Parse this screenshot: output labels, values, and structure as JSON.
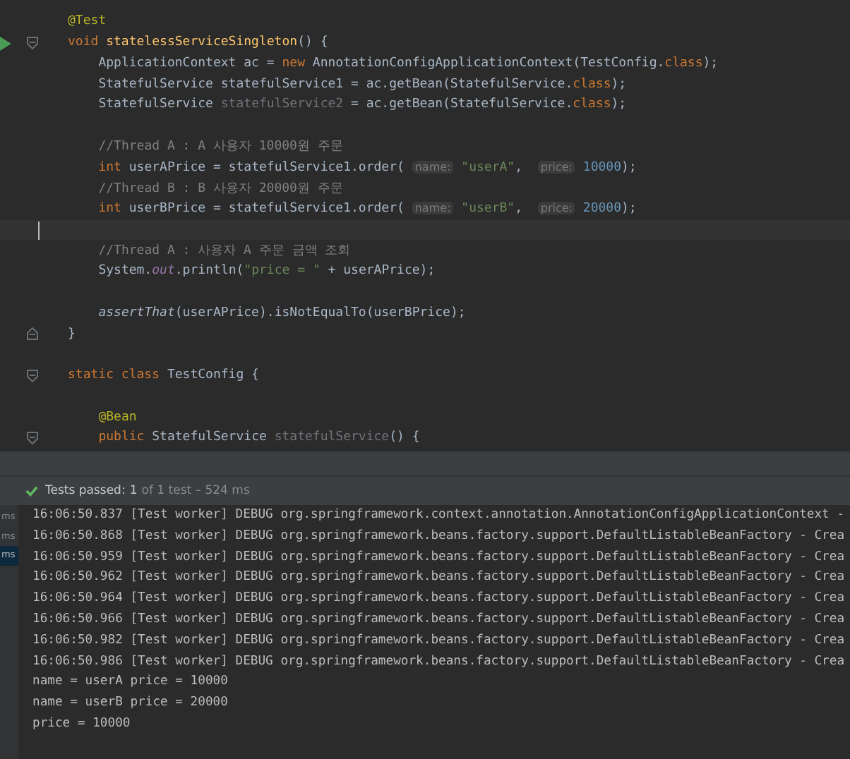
{
  "editor": {
    "lines": [
      {
        "kind": "code",
        "tokens": [
          {
            "kind": "ann",
            "t": "@Test"
          }
        ]
      },
      {
        "kind": "code",
        "run_button": true,
        "fold_start": true,
        "tokens": [
          {
            "kind": "kw",
            "t": "void "
          },
          {
            "kind": "decl",
            "t": "statelessServiceSingleton"
          },
          {
            "kind": "plain",
            "t": "() {"
          }
        ]
      },
      {
        "kind": "code",
        "tokens": [
          {
            "kind": "plain",
            "t": "    ApplicationContext ac = "
          },
          {
            "kind": "kw",
            "t": "new "
          },
          {
            "kind": "plain",
            "t": "AnnotationConfigApplicationContext(TestConfig."
          },
          {
            "kind": "kw",
            "t": "class"
          },
          {
            "kind": "plain",
            "t": ");"
          }
        ]
      },
      {
        "kind": "code",
        "tokens": [
          {
            "kind": "plain",
            "t": "    StatefulService statefulService1 = ac.getBean(StatefulService."
          },
          {
            "kind": "kw",
            "t": "class"
          },
          {
            "kind": "plain",
            "t": ");"
          }
        ]
      },
      {
        "kind": "code",
        "tokens": [
          {
            "kind": "plain",
            "t": "    StatefulService "
          },
          {
            "kind": "unused",
            "t": "statefulService2"
          },
          {
            "kind": "plain",
            "t": " = ac.getBean(StatefulService."
          },
          {
            "kind": "kw",
            "t": "class"
          },
          {
            "kind": "plain",
            "t": ");"
          }
        ]
      },
      {
        "kind": "blank"
      },
      {
        "kind": "code",
        "tokens": [
          {
            "kind": "cmt",
            "t": "    //Thread A : A 사용자 10000원 주문"
          }
        ]
      },
      {
        "kind": "code",
        "tokens": [
          {
            "kind": "kw",
            "t": "    int "
          },
          {
            "kind": "plain",
            "t": "userAPrice = statefulService1.order( "
          },
          {
            "kind": "hint",
            "t": "name:"
          },
          {
            "kind": "str",
            "t": " \"userA\""
          },
          {
            "kind": "plain",
            "t": ",  "
          },
          {
            "kind": "hint",
            "t": "price:"
          },
          {
            "kind": "num",
            "t": " 10000"
          },
          {
            "kind": "plain",
            "t": ");"
          }
        ]
      },
      {
        "kind": "code",
        "tokens": [
          {
            "kind": "cmt",
            "t": "    //Thread B : B 사용자 20000원 주문"
          }
        ]
      },
      {
        "kind": "code",
        "tokens": [
          {
            "kind": "kw",
            "t": "    int "
          },
          {
            "kind": "plain",
            "t": "userBPrice = statefulService1.order( "
          },
          {
            "kind": "hint",
            "t": "name:"
          },
          {
            "kind": "str",
            "t": " \"userB\""
          },
          {
            "kind": "plain",
            "t": ",  "
          },
          {
            "kind": "hint",
            "t": "price:"
          },
          {
            "kind": "num",
            "t": " 20000"
          },
          {
            "kind": "plain",
            "t": ");"
          }
        ]
      },
      {
        "kind": "blank",
        "current": true
      },
      {
        "kind": "code",
        "tokens": [
          {
            "kind": "cmt",
            "t": "    //Thread A : 사용자 A 주문 금액 조회"
          }
        ]
      },
      {
        "kind": "code",
        "tokens": [
          {
            "kind": "plain",
            "t": "    System."
          },
          {
            "kind": "field",
            "t": "out"
          },
          {
            "kind": "plain",
            "t": ".println("
          },
          {
            "kind": "str",
            "t": "\"price = \""
          },
          {
            "kind": "plain",
            "t": " + userAPrice);"
          }
        ]
      },
      {
        "kind": "blank"
      },
      {
        "kind": "code",
        "tokens": [
          {
            "kind": "italic",
            "t": "    assertThat"
          },
          {
            "kind": "plain",
            "t": "(userAPrice).isNotEqualTo(userBPrice);"
          }
        ]
      },
      {
        "kind": "code",
        "fold_end": true,
        "tokens": [
          {
            "kind": "plain",
            "t": "}"
          }
        ]
      },
      {
        "kind": "blank"
      },
      {
        "kind": "code",
        "fold_start": true,
        "tokens": [
          {
            "kind": "kw",
            "t": "static class "
          },
          {
            "kind": "plain",
            "t": "TestConfig {"
          }
        ]
      },
      {
        "kind": "blank"
      },
      {
        "kind": "code",
        "tokens": [
          {
            "kind": "ann",
            "t": "    @Bean"
          }
        ]
      },
      {
        "kind": "code",
        "fold_start": true,
        "tokens": [
          {
            "kind": "kw",
            "t": "    public "
          },
          {
            "kind": "plain",
            "t": "StatefulService "
          },
          {
            "kind": "unused",
            "t": "statefulService"
          },
          {
            "kind": "plain",
            "t": "() {"
          }
        ]
      }
    ]
  },
  "test_panel": {
    "status": "Tests passed:",
    "count": "1",
    "detail": "of 1 test – 524 ms",
    "tree": [
      {
        "duration": "ms",
        "selected": false
      },
      {
        "duration": "ms",
        "selected": false
      },
      {
        "duration": "ms",
        "selected": true
      }
    ],
    "log": [
      "16:06:50.837 [Test worker] DEBUG org.springframework.context.annotation.AnnotationConfigApplicationContext -",
      "16:06:50.868 [Test worker] DEBUG org.springframework.beans.factory.support.DefaultListableBeanFactory - Crea",
      "16:06:50.959 [Test worker] DEBUG org.springframework.beans.factory.support.DefaultListableBeanFactory - Crea",
      "16:06:50.962 [Test worker] DEBUG org.springframework.beans.factory.support.DefaultListableBeanFactory - Crea",
      "16:06:50.964 [Test worker] DEBUG org.springframework.beans.factory.support.DefaultListableBeanFactory - Crea",
      "16:06:50.966 [Test worker] DEBUG org.springframework.beans.factory.support.DefaultListableBeanFactory - Crea",
      "16:06:50.982 [Test worker] DEBUG org.springframework.beans.factory.support.DefaultListableBeanFactory - Crea",
      "16:06:50.986 [Test worker] DEBUG org.springframework.beans.factory.support.DefaultListableBeanFactory - Crea",
      "name = userA price = 10000",
      "name = userB price = 20000",
      "price = 10000"
    ]
  }
}
